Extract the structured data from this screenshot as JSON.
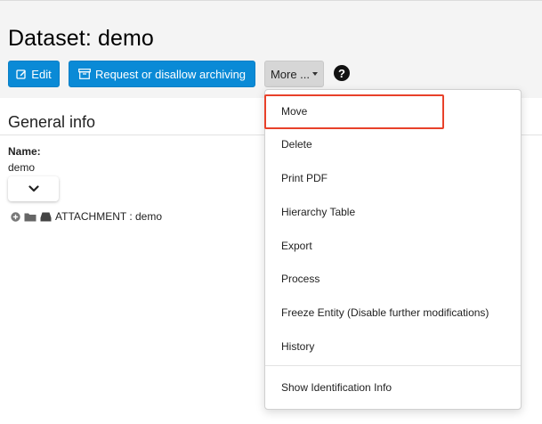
{
  "page": {
    "title": "Dataset: demo"
  },
  "toolbar": {
    "edit_label": "Edit",
    "archive_label": "Request or disallow archiving",
    "more_label": "More ...",
    "help_label": "?"
  },
  "general_info": {
    "section_title": "General info",
    "name_label": "Name:",
    "name_value": "demo"
  },
  "tree": {
    "attachment_label": "ATTACHMENT : demo"
  },
  "dropdown": {
    "items": [
      "Move",
      "Delete",
      "Print PDF",
      "Hierarchy Table",
      "Export",
      "Process",
      "Freeze Entity (Disable further modifications)",
      "History",
      "Show Identification Info"
    ]
  },
  "colors": {
    "primary": "#0a8ad6",
    "highlight": "#e8412a",
    "header_bg": "#f4f4f4"
  }
}
